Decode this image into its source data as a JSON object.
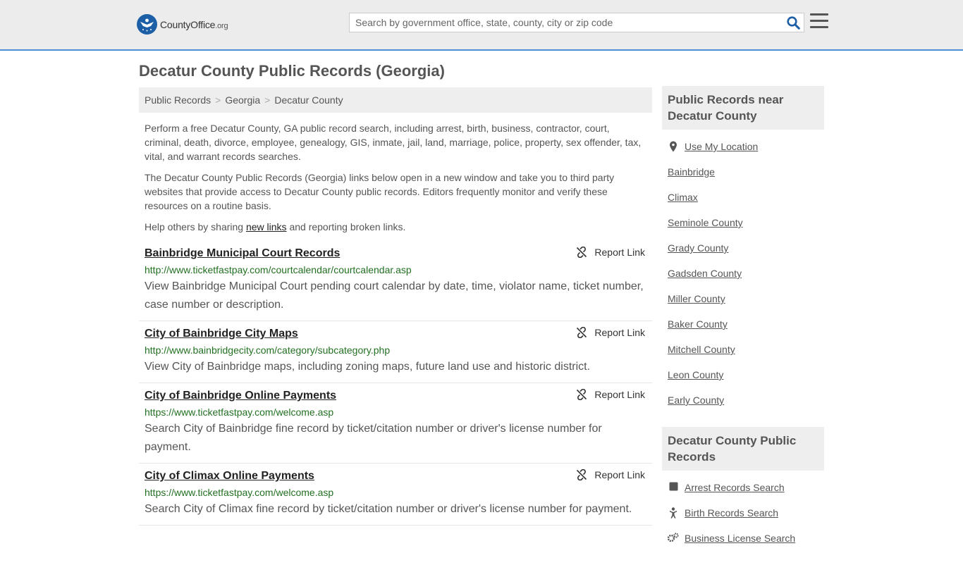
{
  "header": {
    "logo_text_main": "CountyOffice",
    "logo_text_suffix": ".org",
    "search_placeholder": "Search by government office, state, county, city or zip code"
  },
  "page_title": "Decatur County Public Records (Georgia)",
  "breadcrumb": [
    "Public Records",
    "Georgia",
    "Decatur County"
  ],
  "intro": {
    "p1": "Perform a free Decatur County, GA public record search, including arrest, birth, business, contractor, court, criminal, death, divorce, employee, genealogy, GIS, inmate, jail, land, marriage, police, property, sex offender, tax, vital, and warrant records searches.",
    "p2": "The Decatur County Public Records (Georgia) links below open in a new window and take you to third party websites that provide access to Decatur County public records. Editors frequently monitor and verify these resources on a routine basis.",
    "p3_before": "Help others by sharing ",
    "p3_link": "new links",
    "p3_after": " and reporting broken links."
  },
  "report_label": "Report Link",
  "records": [
    {
      "title": "Bainbridge Municipal Court Records",
      "url": "http://www.ticketfastpay.com/courtcalendar/courtcalendar.asp",
      "desc": "View Bainbridge Municipal Court pending court calendar by date, time, violator name, ticket number, case number or description."
    },
    {
      "title": "City of Bainbridge City Maps",
      "url": "http://www.bainbridgecity.com/category/subcategory.php",
      "desc": "View City of Bainbridge maps, including zoning maps, future land use and historic district."
    },
    {
      "title": "City of Bainbridge Online Payments",
      "url": "https://www.ticketfastpay.com/welcome.asp",
      "desc": "Search City of Bainbridge fine record by ticket/citation number or driver's license number for payment."
    },
    {
      "title": "City of Climax Online Payments",
      "url": "https://www.ticketfastpay.com/welcome.asp",
      "desc": "Search City of Climax fine record by ticket/citation number or driver's license number for payment."
    }
  ],
  "sidebar": {
    "near_heading": "Public Records near Decatur County",
    "use_location": "Use My Location",
    "near_items": [
      "Bainbridge",
      "Climax",
      "Seminole County",
      "Grady County",
      "Gadsden County",
      "Miller County",
      "Baker County",
      "Mitchell County",
      "Leon County",
      "Early County"
    ],
    "records_heading": "Decatur County Public Records",
    "record_items": [
      {
        "label": "Arrest Records Search",
        "icon": "square-icon"
      },
      {
        "label": "Birth Records Search",
        "icon": "baby-icon"
      },
      {
        "label": "Business License Search",
        "icon": "gears-icon"
      }
    ]
  },
  "colors": {
    "accent_border": "#4a8fd4",
    "logo_blue": "#1d5fa7",
    "url_green": "#237023"
  }
}
